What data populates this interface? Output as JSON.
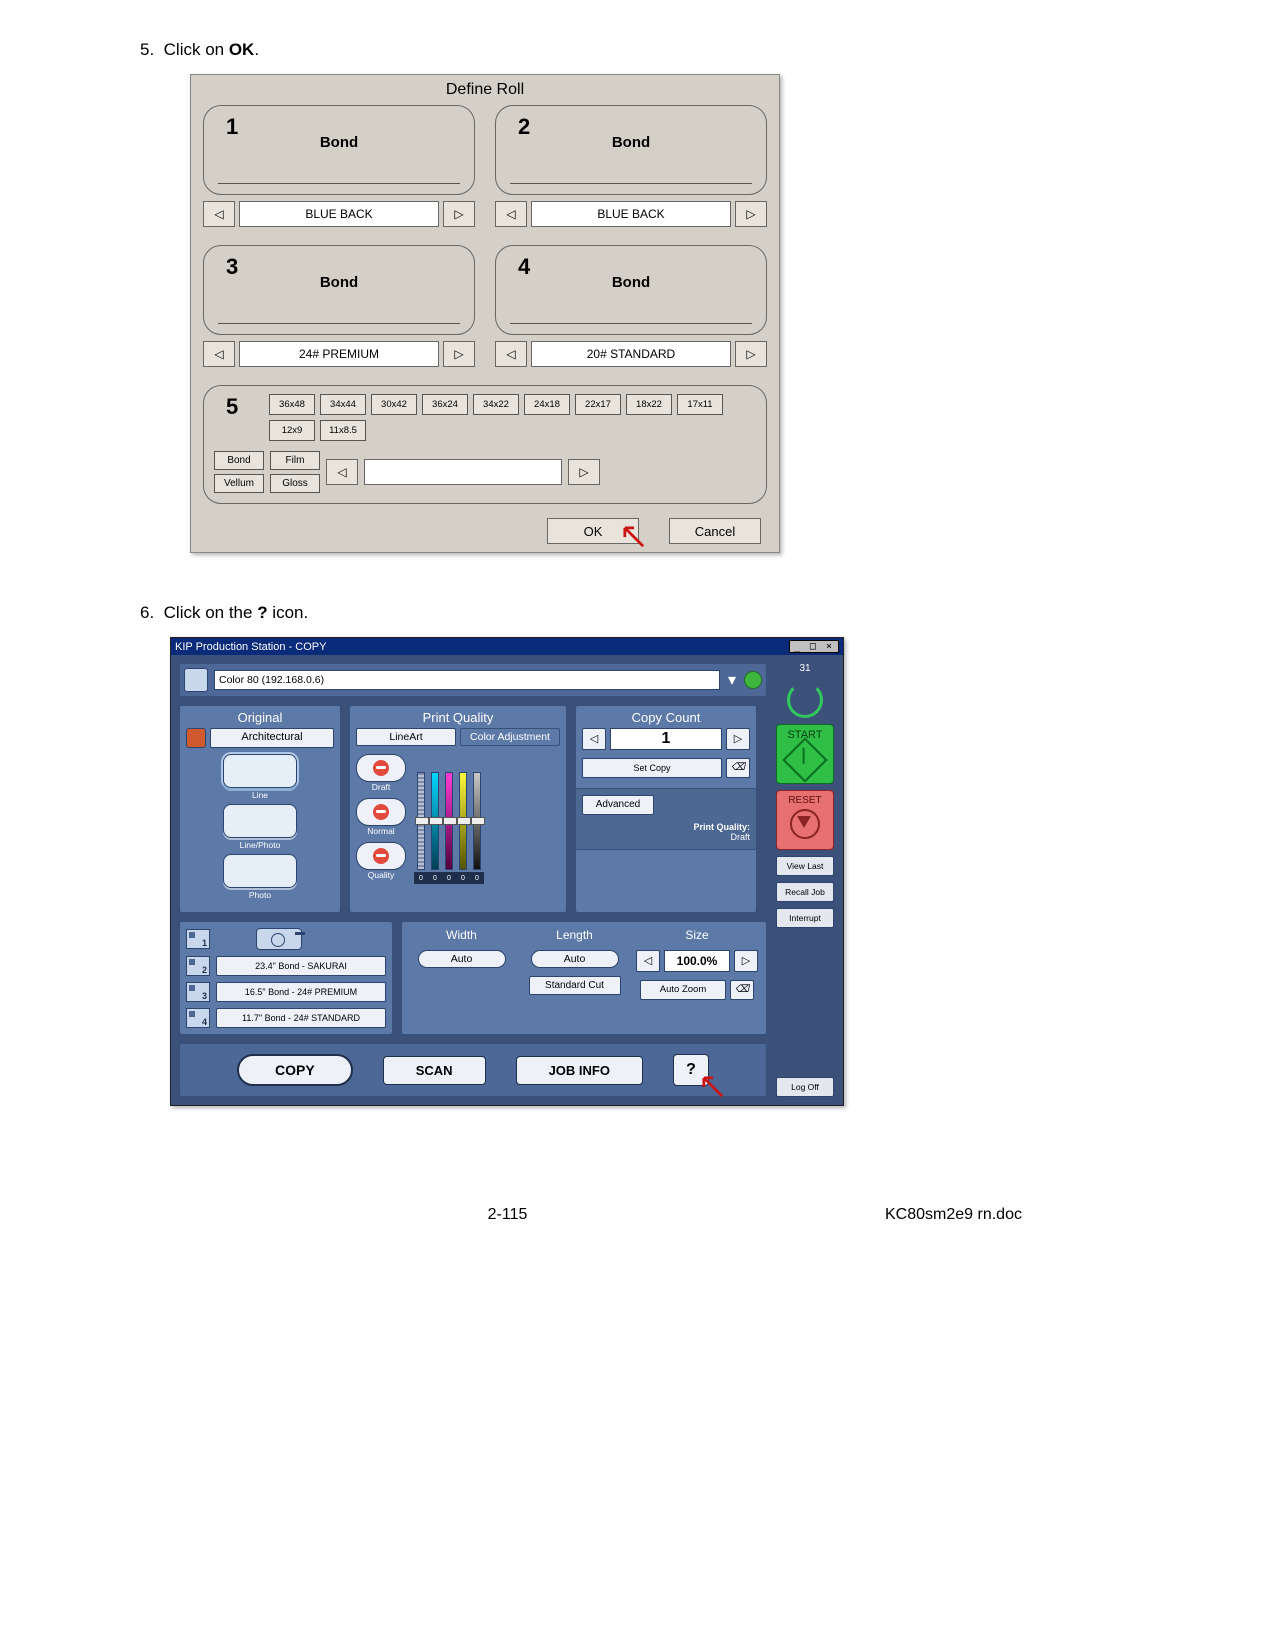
{
  "step5": {
    "num": "5.",
    "text_a": "Click on ",
    "text_b": "OK",
    "text_c": "."
  },
  "step6": {
    "num": "6.",
    "text_a": "Click on the ",
    "text_b": "?",
    "text_c": " icon."
  },
  "define_roll": {
    "title": "Define Roll",
    "slots": [
      {
        "num": "1",
        "type": "Bond",
        "sel": "BLUE BACK"
      },
      {
        "num": "2",
        "type": "Bond",
        "sel": "BLUE BACK"
      },
      {
        "num": "3",
        "type": "Bond",
        "sel": "24# PREMIUM"
      },
      {
        "num": "4",
        "type": "Bond",
        "sel": "20# STANDARD"
      }
    ],
    "slot5": {
      "num": "5",
      "sizes": [
        "36x48",
        "34x44",
        "30x42",
        "36x24",
        "34x22",
        "24x18",
        "22x17",
        "18x22",
        "17x11",
        "12x9",
        "11x8.5"
      ],
      "materials": [
        [
          "Bond",
          "Film"
        ],
        [
          "Vellum",
          "Gloss"
        ]
      ]
    },
    "ok": "OK",
    "cancel": "Cancel"
  },
  "kip": {
    "titlebar": "KIP Production Station - COPY",
    "address": "Color 80 (192.168.0.6)",
    "side": {
      "count": "31",
      "start": "START",
      "reset": "RESET",
      "viewlast": "View Last",
      "recall": "Recall Job",
      "interrupt": "Interrupt",
      "logoff": "Log Off"
    },
    "original": {
      "title": "Original",
      "type": "Architectural",
      "opts": [
        "Line",
        "Line/Photo",
        "Photo"
      ]
    },
    "pq": {
      "title": "Print Quality",
      "tab_a": "LineArt",
      "tab_b": "Color Adjustment",
      "levels": [
        "Draft",
        "Normal",
        "Quality"
      ],
      "slider_val": "0"
    },
    "cc": {
      "title": "Copy Count",
      "value": "1",
      "setcopy": "Set Copy",
      "advanced": "Advanced",
      "pq_label_a": "Print Quality:",
      "pq_label_b": "Draft"
    },
    "rolls": [
      {
        "n": "1",
        "label": ""
      },
      {
        "n": "2",
        "label": "23.4\" Bond - SAKURAI"
      },
      {
        "n": "3",
        "label": "16.5\" Bond - 24# PREMIUM"
      },
      {
        "n": "4",
        "label": "11.7\" Bond - 24# STANDARD"
      }
    ],
    "width": {
      "title": "Width",
      "val": "Auto"
    },
    "length": {
      "title": "Length",
      "val": "Auto",
      "std": "Standard Cut"
    },
    "size": {
      "title": "Size",
      "val": "100.0%",
      "az": "Auto Zoom"
    },
    "bottom": {
      "copy": "COPY",
      "scan": "SCAN",
      "jobinfo": "JOB INFO",
      "help": "?"
    }
  },
  "footer": {
    "page": "2-115",
    "doc": "KC80sm2e9 rn.doc"
  }
}
